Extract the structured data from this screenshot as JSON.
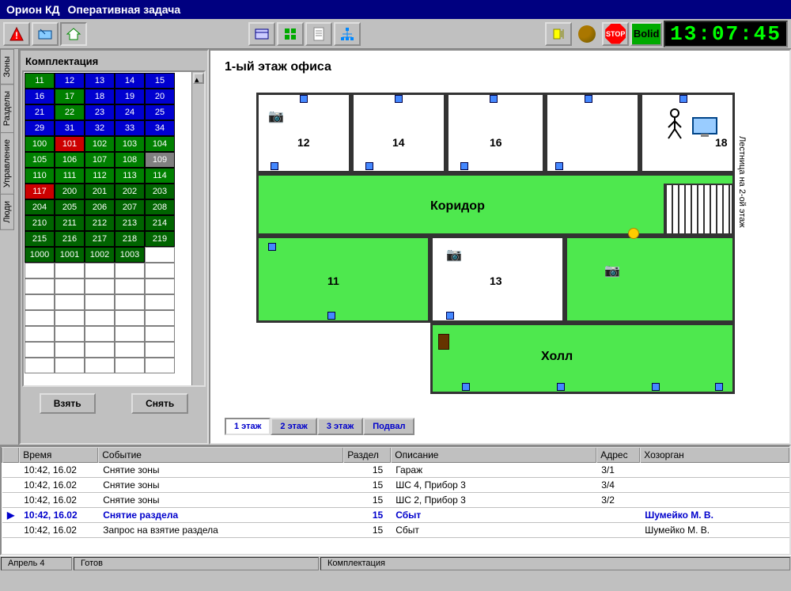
{
  "title": {
    "app": "Орион КД",
    "task": "Оперативная задача"
  },
  "clock": "13:07:45",
  "bolid_label": "Bolid",
  "stop_label": "STOP",
  "side_tabs": [
    "Зоны",
    "Разделы",
    "Управление",
    "Люди"
  ],
  "panel_title": "Комплектация",
  "grid_cells": [
    {
      "n": "11",
      "c": "green"
    },
    {
      "n": "12",
      "c": "blue"
    },
    {
      "n": "13",
      "c": "blue"
    },
    {
      "n": "14",
      "c": "blue"
    },
    {
      "n": "15",
      "c": "blue"
    },
    {
      "n": "16",
      "c": "blue"
    },
    {
      "n": "17",
      "c": "green"
    },
    {
      "n": "18",
      "c": "blue"
    },
    {
      "n": "19",
      "c": "blue"
    },
    {
      "n": "20",
      "c": "blue"
    },
    {
      "n": "21",
      "c": "blue"
    },
    {
      "n": "22",
      "c": "green"
    },
    {
      "n": "23",
      "c": "blue"
    },
    {
      "n": "24",
      "c": "blue"
    },
    {
      "n": "25",
      "c": "blue"
    },
    {
      "n": "29",
      "c": "blue"
    },
    {
      "n": "31",
      "c": "blue"
    },
    {
      "n": "32",
      "c": "blue"
    },
    {
      "n": "33",
      "c": "blue"
    },
    {
      "n": "34",
      "c": "blue"
    },
    {
      "n": "100",
      "c": "green"
    },
    {
      "n": "101",
      "c": "red"
    },
    {
      "n": "102",
      "c": "green"
    },
    {
      "n": "103",
      "c": "green"
    },
    {
      "n": "104",
      "c": "green"
    },
    {
      "n": "105",
      "c": "green"
    },
    {
      "n": "106",
      "c": "green"
    },
    {
      "n": "107",
      "c": "green"
    },
    {
      "n": "108",
      "c": "green"
    },
    {
      "n": "109",
      "c": "gray"
    },
    {
      "n": "110",
      "c": "green"
    },
    {
      "n": "111",
      "c": "green"
    },
    {
      "n": "112",
      "c": "green"
    },
    {
      "n": "113",
      "c": "green"
    },
    {
      "n": "114",
      "c": "green"
    },
    {
      "n": "117",
      "c": "red"
    },
    {
      "n": "200",
      "c": "dgreen"
    },
    {
      "n": "201",
      "c": "dgreen"
    },
    {
      "n": "202",
      "c": "dgreen"
    },
    {
      "n": "203",
      "c": "dgreen"
    },
    {
      "n": "204",
      "c": "dgreen"
    },
    {
      "n": "205",
      "c": "dgreen"
    },
    {
      "n": "206",
      "c": "dgreen"
    },
    {
      "n": "207",
      "c": "dgreen"
    },
    {
      "n": "208",
      "c": "dgreen"
    },
    {
      "n": "210",
      "c": "dgreen"
    },
    {
      "n": "211",
      "c": "dgreen"
    },
    {
      "n": "212",
      "c": "dgreen"
    },
    {
      "n": "213",
      "c": "dgreen"
    },
    {
      "n": "214",
      "c": "dgreen"
    },
    {
      "n": "215",
      "c": "dgreen"
    },
    {
      "n": "216",
      "c": "dgreen"
    },
    {
      "n": "217",
      "c": "dgreen"
    },
    {
      "n": "218",
      "c": "dgreen"
    },
    {
      "n": "219",
      "c": "dgreen"
    },
    {
      "n": "1000",
      "c": "dgreen"
    },
    {
      "n": "1001",
      "c": "dgreen"
    },
    {
      "n": "1002",
      "c": "dgreen"
    },
    {
      "n": "1003",
      "c": "dgreen"
    }
  ],
  "buttons": {
    "arm": "Взять",
    "disarm": "Снять"
  },
  "plan": {
    "title": "1-ый этаж офиса",
    "rooms": {
      "r11": "11",
      "r12": "12",
      "r13": "13",
      "r14": "14",
      "r16": "16",
      "r18": "18",
      "corridor": "Коридор",
      "hall": "Холл"
    },
    "stair_label": "Лестница на 2-ой этаж"
  },
  "floor_tabs": [
    "1 этаж",
    "2 этаж",
    "3 этаж",
    "Подвал"
  ],
  "log": {
    "headers": [
      "Время",
      "Событие",
      "Раздел",
      "Описание",
      "Адрес",
      "Хозорган"
    ],
    "rows": [
      {
        "t": "10:42, 16.02",
        "e": "Снятие зоны",
        "r": "15",
        "d": "Гараж",
        "a": "3/1",
        "h": ""
      },
      {
        "t": "10:42, 16.02",
        "e": "Снятие зоны",
        "r": "15",
        "d": "ШС 4, Прибор 3",
        "a": "3/4",
        "h": ""
      },
      {
        "t": "10:42, 16.02",
        "e": "Снятие зоны",
        "r": "15",
        "d": "ШС 2, Прибор 3",
        "a": "3/2",
        "h": ""
      },
      {
        "t": "10:42, 16.02",
        "e": "Снятие раздела",
        "r": "15",
        "d": "Сбыт",
        "a": "",
        "h": "Шумейко М. В.",
        "hl": true
      },
      {
        "t": "10:42, 16.02",
        "e": "Запрос на взятие раздела",
        "r": "15",
        "d": "Сбыт",
        "a": "",
        "h": "Шумейко М. В."
      }
    ]
  },
  "statusbar": {
    "date": "Апрель 4",
    "state": "Готов",
    "mode": "Комплектация"
  }
}
